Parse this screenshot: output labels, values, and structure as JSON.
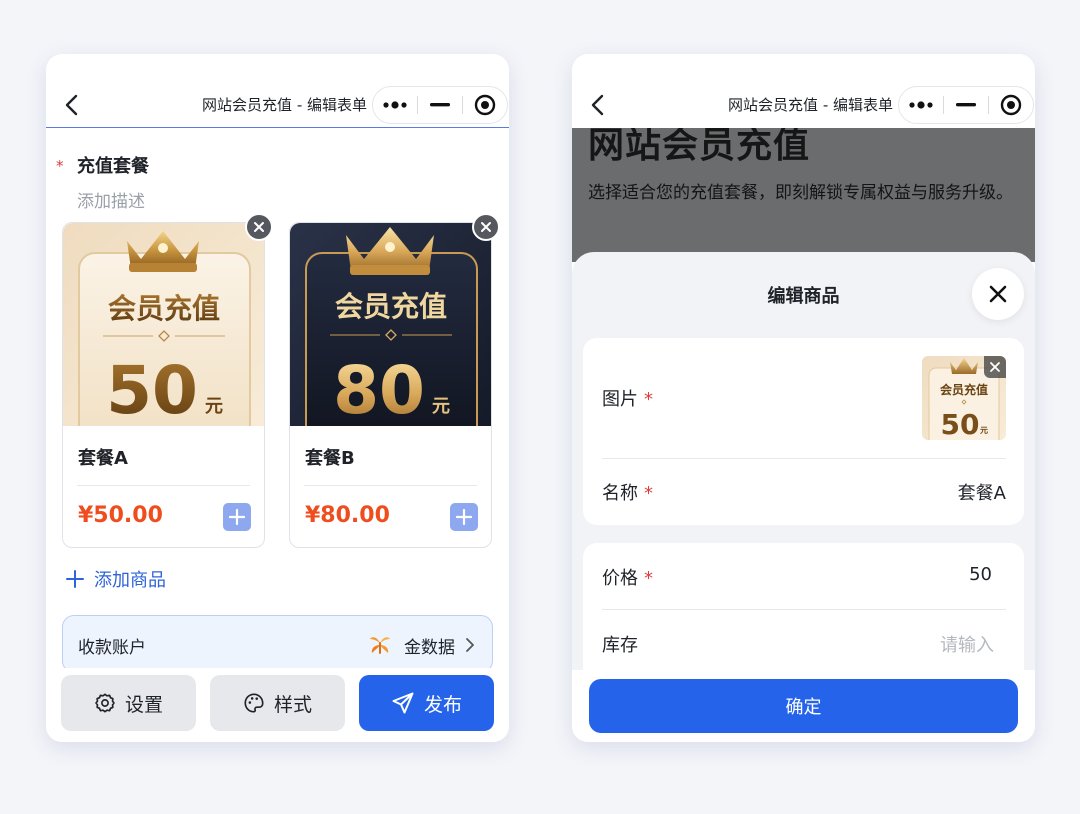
{
  "left": {
    "titlebar": {
      "title": "网站会员充值 - 编辑表单"
    },
    "section": {
      "required_mark": "*",
      "title": "充值套餐",
      "description": "添加描述"
    },
    "packages": [
      {
        "name": "套餐A",
        "price": "¥50.00",
        "image": {
          "heading": "会员充值",
          "amount": "50",
          "unit": "元",
          "theme": "gold"
        }
      },
      {
        "name": "套餐B",
        "price": "¥80.00",
        "image": {
          "heading": "会员充值",
          "amount": "80",
          "unit": "元",
          "theme": "navy"
        }
      }
    ],
    "add_goods_label": "添加商品",
    "account": {
      "label": "收款账户",
      "value": "金数据"
    },
    "bottom_buttons": {
      "settings": "设置",
      "style": "样式",
      "publish": "发布"
    }
  },
  "right": {
    "titlebar": {
      "title": "网站会员充值 - 编辑表单"
    },
    "background_page": {
      "title": "网站会员充值",
      "text": "选择适合您的充值套餐，即刻解锁专属权益与服务升级。"
    },
    "sheet": {
      "title": "编辑商品",
      "image_label": "图片",
      "thumbnail": {
        "heading": "会员充值",
        "amount": "50",
        "unit": "元"
      },
      "name_label": "名称",
      "name_value": "套餐A",
      "price_label": "价格",
      "price_value": "50",
      "stock_label": "库存",
      "stock_placeholder": "请输入",
      "required_mark": "*",
      "confirm_label": "确定"
    }
  },
  "colors": {
    "accent": "#2563eb",
    "price": "#ef4d1e",
    "required": "#e23b3b",
    "link": "#2f63db"
  }
}
